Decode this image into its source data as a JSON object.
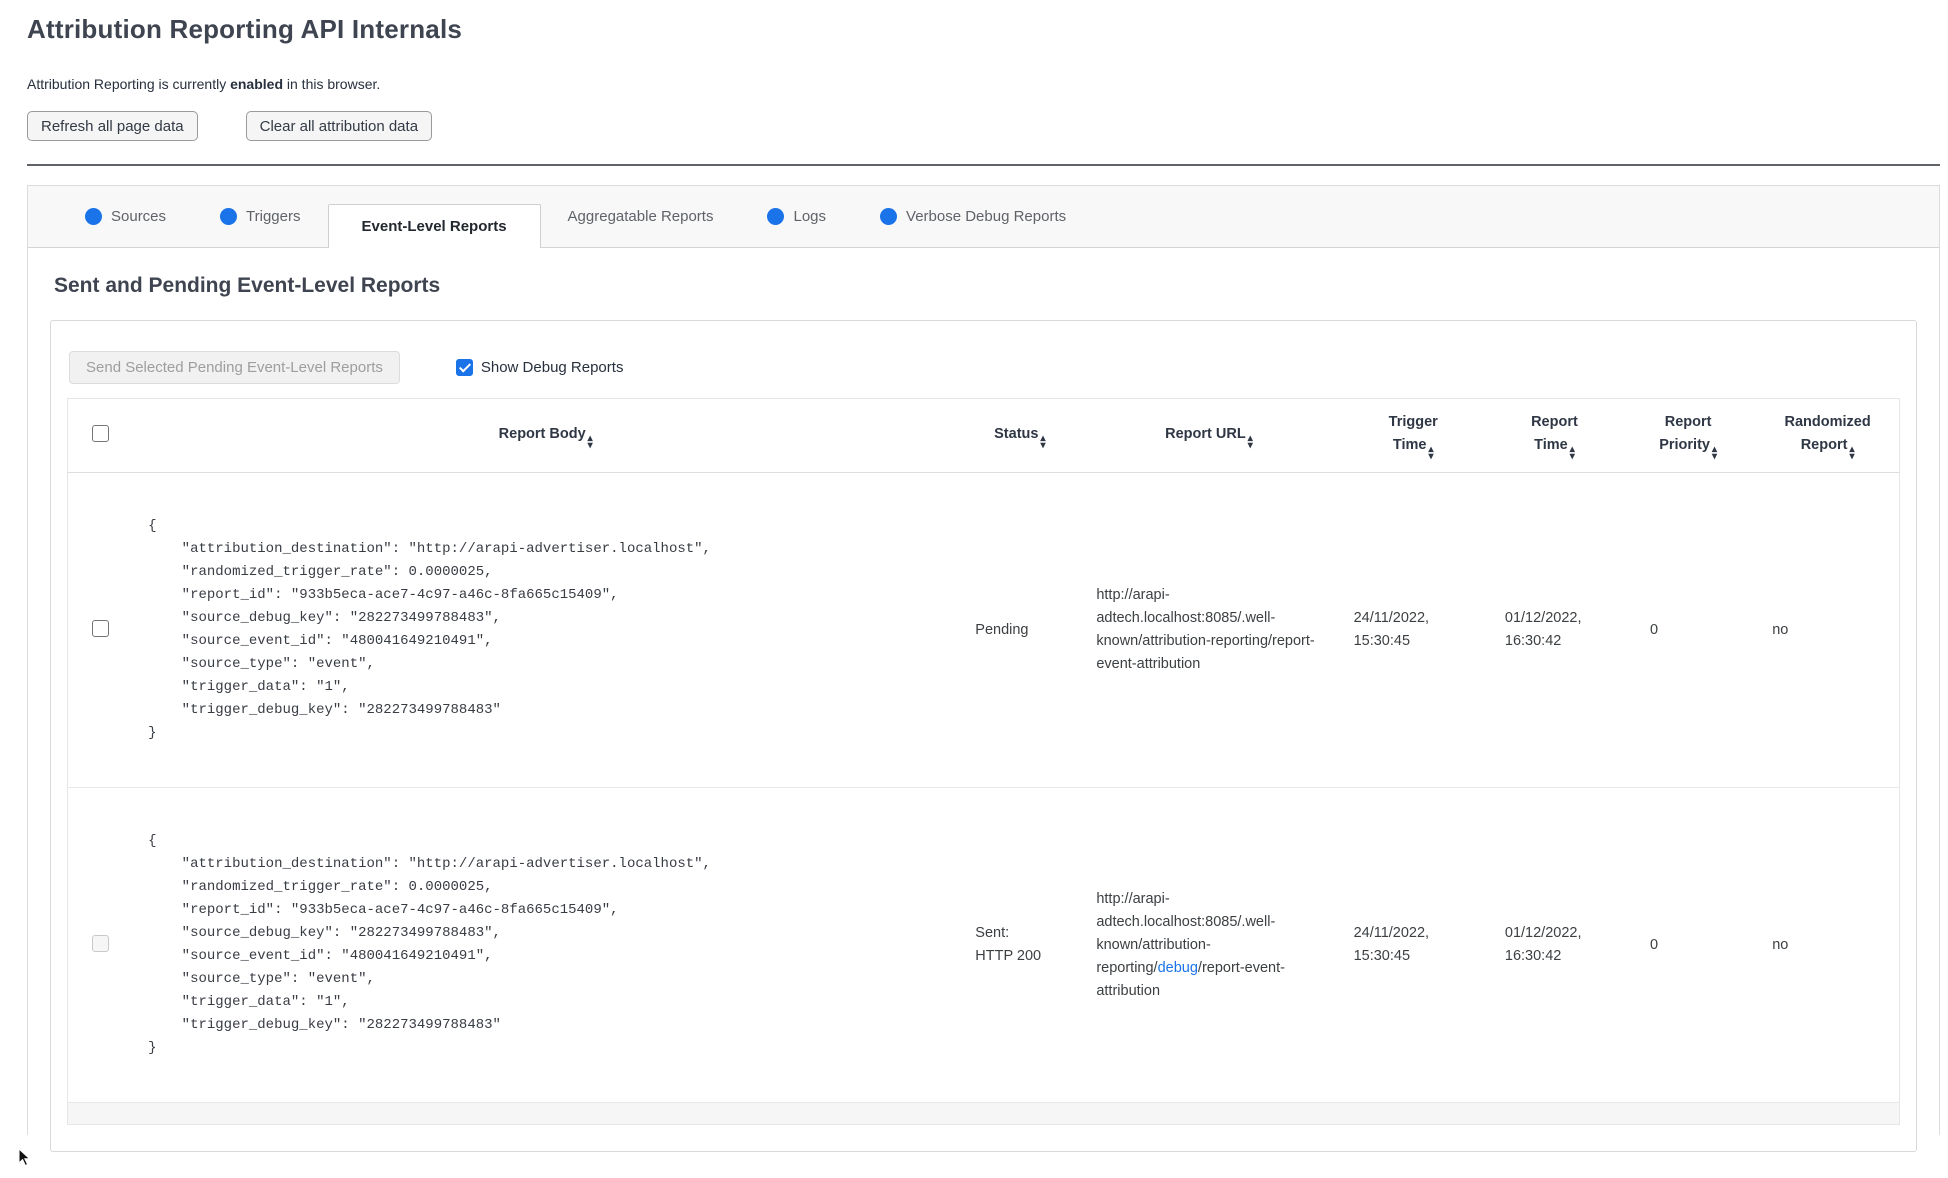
{
  "page": {
    "title": "Attribution Reporting API Internals",
    "status_prefix": "Attribution Reporting is currently ",
    "status_state": "enabled",
    "status_suffix": " in this browser."
  },
  "toolbar": {
    "refresh_label": "Refresh all page data",
    "clear_label": "Clear all attribution data"
  },
  "tabs": {
    "sources": "Sources",
    "triggers": "Triggers",
    "event_level": "Event-Level Reports",
    "aggregatable": "Aggregatable Reports",
    "logs": "Logs",
    "verbose": "Verbose Debug Reports",
    "active_tab": "Event-Level Reports"
  },
  "section": {
    "heading": "Sent and Pending Event-Level Reports",
    "send_button_label": "Send Selected Pending Event-Level Reports",
    "send_button_enabled": false,
    "show_debug_label": "Show Debug Reports",
    "show_debug_checked": true
  },
  "table": {
    "headers": {
      "report_body": "Report Body",
      "status": "Status",
      "report_url": "Report URL",
      "trigger_time": "Trigger Time",
      "report_time": "Report Time",
      "report_priority": "Report Priority",
      "randomized_report": "Randomized Report"
    },
    "rows": [
      {
        "checkbox_enabled": true,
        "report_body": "{\n    \"attribution_destination\": \"http://arapi-advertiser.localhost\",\n    \"randomized_trigger_rate\": 0.0000025,\n    \"report_id\": \"933b5eca-ace7-4c97-a46c-8fa665c15409\",\n    \"source_debug_key\": \"282273499788483\",\n    \"source_event_id\": \"480041649210491\",\n    \"source_type\": \"event\",\n    \"trigger_data\": \"1\",\n    \"trigger_debug_key\": \"282273499788483\"\n}",
        "status": "Pending",
        "url_pre": "http://arapi-adtech.localhost:8085/.well-known/attribution-reporting/report-event-attribution",
        "url_link": "",
        "url_post": "",
        "trigger_time": "24/11/2022, 15:30:45",
        "report_time": "01/12/2022, 16:30:42",
        "report_priority": "0",
        "randomized_report": "no"
      },
      {
        "checkbox_enabled": false,
        "report_body": "{\n    \"attribution_destination\": \"http://arapi-advertiser.localhost\",\n    \"randomized_trigger_rate\": 0.0000025,\n    \"report_id\": \"933b5eca-ace7-4c97-a46c-8fa665c15409\",\n    \"source_debug_key\": \"282273499788483\",\n    \"source_event_id\": \"480041649210491\",\n    \"source_type\": \"event\",\n    \"trigger_data\": \"1\",\n    \"trigger_debug_key\": \"282273499788483\"\n}",
        "status": "Sent: HTTP 200",
        "url_pre": "http://arapi-adtech.localhost:8085/.well-known/attribution-reporting/",
        "url_link": "debug",
        "url_post": "/report-event-attribution",
        "trigger_time": "24/11/2022, 15:30:45",
        "report_time": "01/12/2022, 16:30:42",
        "report_priority": "0",
        "randomized_report": "no"
      }
    ]
  },
  "icons": {
    "sort_icon": "stacked up/down triangles ▴▾",
    "tab_dot": "blue circle ●",
    "checkbox_check": "white checkmark ✓",
    "mouse_cursor": "black arrow pointer"
  },
  "colors": {
    "accent_blue": "#1a73e8",
    "heading_text": "#3e4450",
    "tab_strip_bg": "#f8f8f8",
    "divider": "#5f6368",
    "border_light": "#d9d9d9"
  }
}
